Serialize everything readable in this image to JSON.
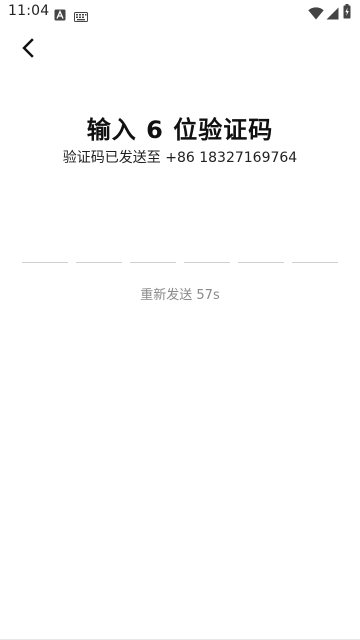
{
  "status_bar": {
    "time": "11:04",
    "icons": [
      "notification-a-icon",
      "keyboard-icon",
      "wifi-icon",
      "signal-icon",
      "battery-icon"
    ]
  },
  "header": {
    "back_icon": "chevron-left-icon"
  },
  "main": {
    "title": "输入 6 位验证码",
    "subtitle": "验证码已发送至 +86 18327169764",
    "code_slots": 6,
    "resend_text": "重新发送 57s"
  }
}
